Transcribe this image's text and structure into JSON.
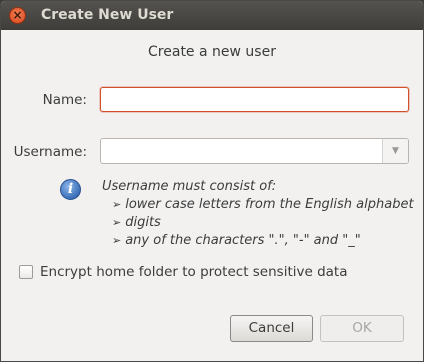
{
  "window": {
    "title": "Create New User",
    "close_glyph": "×"
  },
  "dialog": {
    "heading": "Create a new user",
    "name_label": "Name:",
    "name_value": "",
    "username_label": "Username:",
    "username_value": "",
    "info_glyph": "i",
    "hint": {
      "intro": "Username must consist of:",
      "bullet_glyph": "➢",
      "items": [
        "lower case letters from the English alphabet",
        "digits",
        "any of the characters \".\", \"-\" and \"_\""
      ]
    },
    "encrypt_label": "Encrypt home folder to protect sensitive data",
    "encrypt_checked": false,
    "cancel_label": "Cancel",
    "ok_label": "OK",
    "ok_enabled": false
  },
  "icons": {
    "close": "close-icon",
    "info": "info-icon",
    "dropdown": "chevron-down-icon"
  },
  "colors": {
    "titlebar": "#3e3d39",
    "focus_border": "#d24f2a",
    "info_blue": "#3a6fb8",
    "dialog_bg": "#f2f1f0"
  }
}
